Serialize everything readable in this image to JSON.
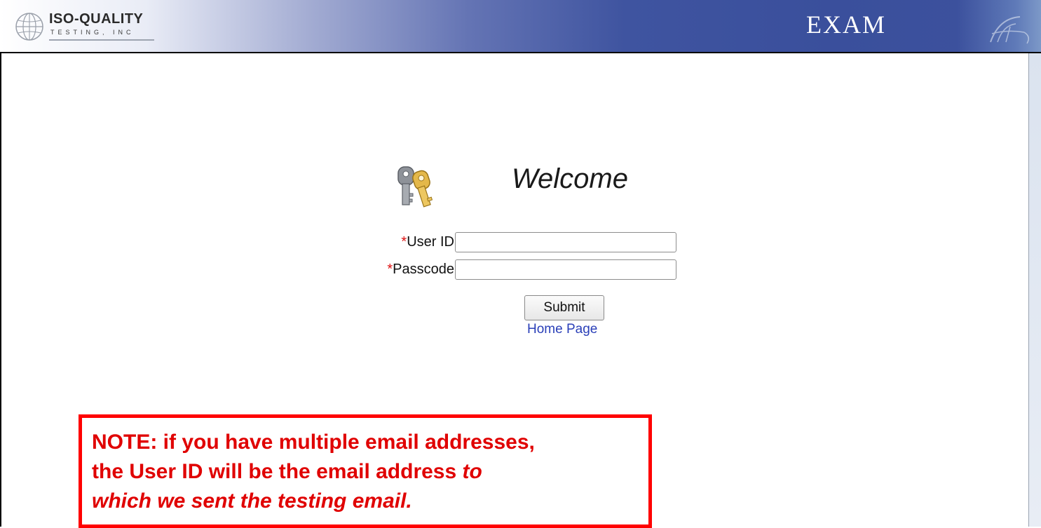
{
  "header": {
    "logo_main": "ISO-QUALITY",
    "logo_sub": "TESTING, INC",
    "title": "EXAM"
  },
  "login": {
    "welcome": "Welcome",
    "required_marker": "*",
    "user_id_label": "User ID",
    "passcode_label": "Passcode",
    "user_id_value": "",
    "passcode_value": "",
    "submit_label": "Submit",
    "home_link_label": "Home Page"
  },
  "note": {
    "line_1": "NOTE: if you have multiple email addresses,",
    "line_2_plain": "the User ID will be the email address ",
    "line_2_italic": "to",
    "line_3_italic": "which we sent the testing email."
  },
  "colors": {
    "banner_blue": "#3a4f9c",
    "required_red": "#dd1111",
    "note_red": "#e00000",
    "link_blue": "#2a3fb8"
  },
  "icons": [
    "globe-icon",
    "keys-icon"
  ]
}
